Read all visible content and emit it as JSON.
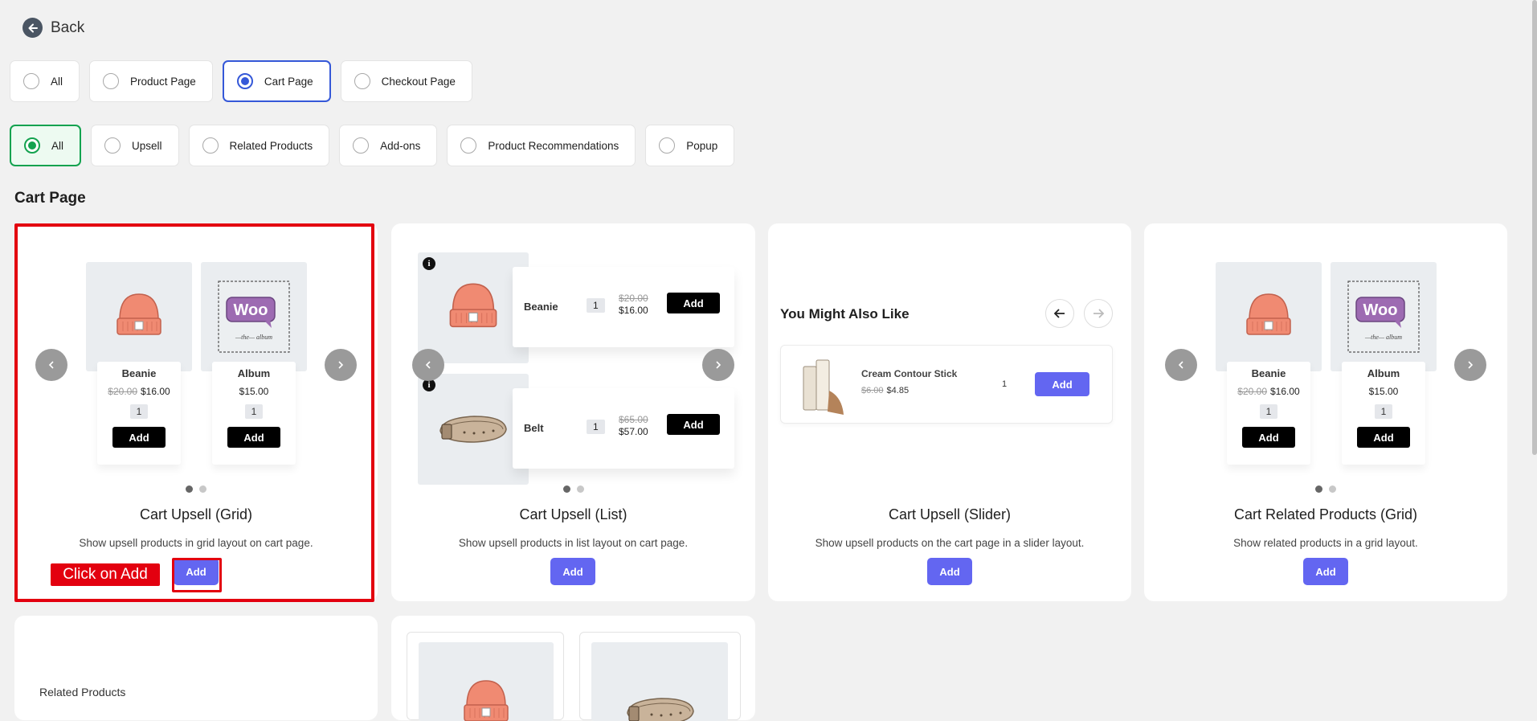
{
  "back_label": "Back",
  "location_filters": [
    {
      "label": "All",
      "selected": false
    },
    {
      "label": "Product Page",
      "selected": false
    },
    {
      "label": "Cart Page",
      "selected": true
    },
    {
      "label": "Checkout Page",
      "selected": false
    }
  ],
  "type_filters": [
    {
      "label": "All",
      "selected": true
    },
    {
      "label": "Upsell",
      "selected": false
    },
    {
      "label": "Related Products",
      "selected": false
    },
    {
      "label": "Add-ons",
      "selected": false
    },
    {
      "label": "Product Recommendations",
      "selected": false
    },
    {
      "label": "Popup",
      "selected": false
    }
  ],
  "section_title": "Cart Page",
  "products": {
    "beanie": {
      "name": "Beanie",
      "old_price": "$20.00",
      "price": "$16.00",
      "qty": "1",
      "add": "Add"
    },
    "album": {
      "name": "Album",
      "price": "$15.00",
      "qty": "1",
      "add": "Add"
    },
    "belt": {
      "name": "Belt",
      "old_price": "$65.00",
      "price": "$57.00",
      "qty": "1",
      "add": "Add"
    },
    "stick": {
      "name": "Cream Contour Stick",
      "old_price": "$6.00",
      "price": "$4.85",
      "qty": "1",
      "add": "Add"
    }
  },
  "cards": [
    {
      "title": "Cart Upsell (Grid)",
      "desc": "Show upsell products in grid layout on cart page.",
      "add": "Add"
    },
    {
      "title": "Cart Upsell (List)",
      "desc": "Show upsell products in list layout on cart page.",
      "add": "Add"
    },
    {
      "title": "Cart Upsell (Slider)",
      "desc": "Show upsell products on the cart page in a slider layout.",
      "add": "Add"
    },
    {
      "title": "Cart Related Products (Grid)",
      "desc": "Show related products in a grid layout.",
      "add": "Add"
    }
  ],
  "slider_heading": "You Might Also Like",
  "bottom_card_label": "Related Products",
  "callout": "Click on Add",
  "colors": {
    "accent": "#6366f1",
    "highlight": "#e3000f",
    "selected_blue": "#3558d8",
    "selected_green": "#13a24f"
  },
  "info_glyph": "i"
}
